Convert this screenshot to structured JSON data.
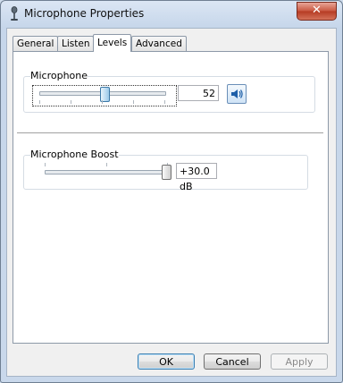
{
  "window": {
    "title": "Microphone Properties",
    "close_label": "✕"
  },
  "tabs": [
    {
      "label": "General",
      "active": false
    },
    {
      "label": "Listen",
      "active": false
    },
    {
      "label": "Levels",
      "active": true
    },
    {
      "label": "Advanced",
      "active": false
    }
  ],
  "levels": {
    "microphone": {
      "label": "Microphone",
      "value_text": "52",
      "level_percent": 52,
      "speaker_icon": "speaker-icon"
    },
    "boost": {
      "label": "Microphone Boost",
      "value_text": "+30.0 dB",
      "level_percent": 100
    }
  },
  "buttons": {
    "ok": "OK",
    "cancel": "Cancel",
    "apply": "Apply"
  }
}
